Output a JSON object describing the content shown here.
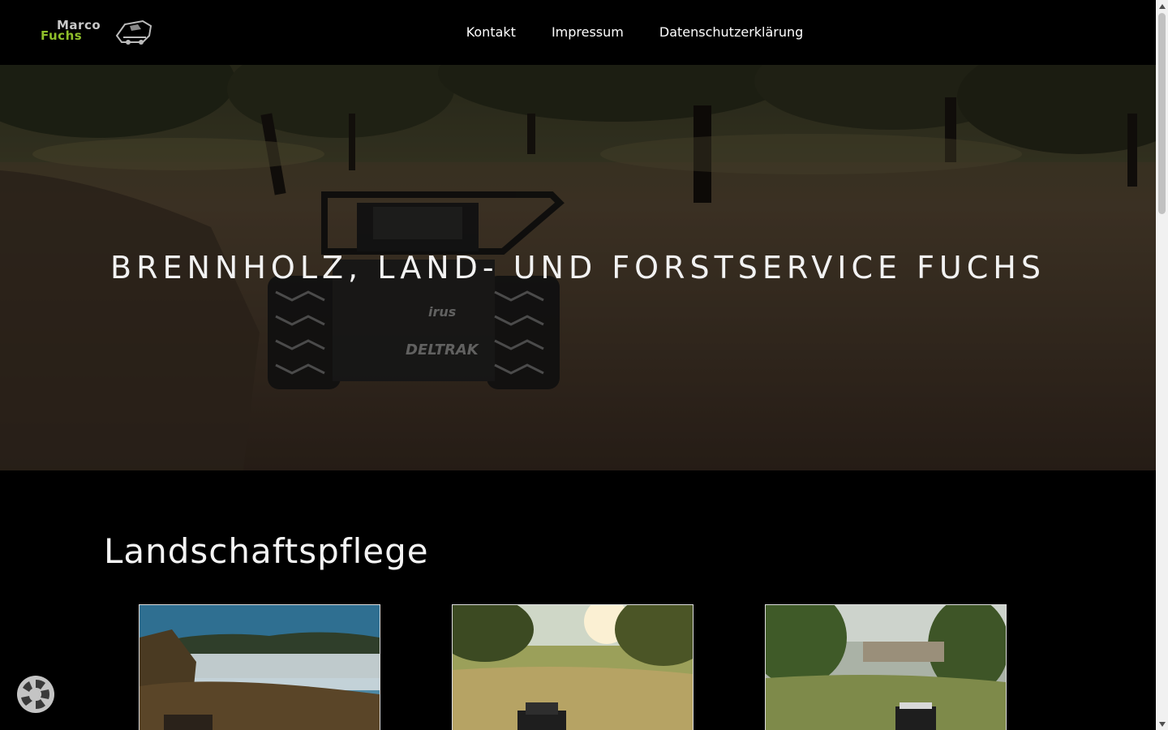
{
  "header": {
    "logo": {
      "line1": "Marco",
      "line2": "Fuchs"
    },
    "nav": [
      {
        "label": "Kontakt"
      },
      {
        "label": "Impressum"
      },
      {
        "label": "Datenschutzerklärung"
      }
    ]
  },
  "hero": {
    "title": "BRENNHOLZ, LAND- UND FORSTSERVICE FUCHS",
    "machine_text": {
      "brand": "DELTRAK",
      "badge": "irus"
    }
  },
  "section": {
    "title": "Landschaftspflege",
    "gallery": [
      {
        "alt": "Nebel über Waldtal"
      },
      {
        "alt": "Mulcher auf Streuobstwiese"
      },
      {
        "alt": "Mulcher auf Wiese mit Ausblick"
      }
    ]
  },
  "cookie": {
    "icon": "cookie-settings-icon"
  }
}
